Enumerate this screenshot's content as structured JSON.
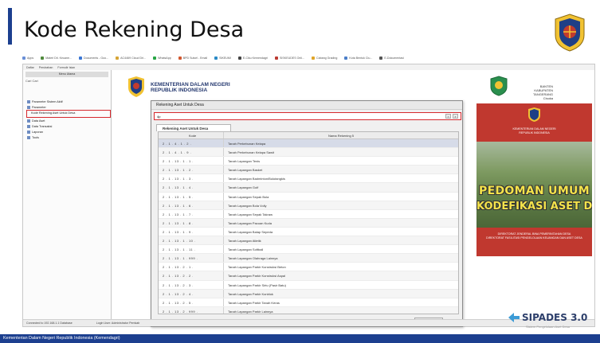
{
  "slide": {
    "title": "Kode Rekening Desa",
    "footer": "Kementerian Dalam Negeri Republik Indonesia (Kemendagri)",
    "accent_color": "#1c3f8f"
  },
  "bookmarks": [
    {
      "label": "Apps",
      "color": "#6a8fd6"
    },
    {
      "label": "Materi Dit. Keuane...",
      "color": "#4f8a3c"
    },
    {
      "label": "Documents - Goo...",
      "color": "#3a76d4"
    },
    {
      "label": "AC4469 Cloud Dri...",
      "color": "#d6a436"
    },
    {
      "label": "WhatsApp",
      "color": "#27a545"
    },
    {
      "label": "BPD Sulsel - Email",
      "color": "#d2582f"
    },
    {
      "label": "SIKEUMI",
      "color": "#2a8ac6"
    },
    {
      "label": "E-Ciku Kemendagri",
      "color": "#444444"
    },
    {
      "label": "SISKEUDES Onli...",
      "color": "#bb3a32"
    },
    {
      "label": "Cabang Grading",
      "color": "#e0a52a"
    },
    {
      "label": "Kota Bentuk Ciu...",
      "color": "#4b7ec9"
    },
    {
      "label": "E-Dokumentasi",
      "color": "#555555"
    }
  ],
  "app": {
    "menu": [
      "Daftar",
      "Perubahan",
      "Formulir Isian"
    ],
    "tree_header": "Menu Utama",
    "tree_tools": "Cari Cari",
    "tree_items": [
      "Parameter Sistem Aktif",
      "Parameter",
      "Kode Rekening Aset Untuk Desa",
      "Data Aset",
      "Data Transaksi",
      "Laporan",
      "Tools"
    ],
    "status_left": "Connected to 192.168.1.1 Database",
    "status_right": "Login User: Administrator Pemkab",
    "header": {
      "org_line1": "KEMENTERIAN DALAM NEGERI",
      "org_line2": "REPUBLIK INDONESIA",
      "region_line1": "BANTEN",
      "region_line2": "KABUPATEN TANGERANG",
      "region_line3": "Cisoka"
    }
  },
  "dialog": {
    "title": "Rekening Aset Untuk Desa",
    "search_value": "4p",
    "search_placeholder": "",
    "search_btn_1": "×",
    "search_btn_2": "⌕",
    "tab_label": "Rekening Aset Untuk Desa",
    "col_kode": "Kode",
    "col_nama": "Nama Rekening 5",
    "rows": [
      {
        "kode": "2 . 1 . 4 . 1 . 2 .",
        "nama": "Tanah Perkebunan Kelapa"
      },
      {
        "kode": "2 . 1 . 4 . 1 . 9 .",
        "nama": "Tanah Perkebunan Kelapa Sawit"
      },
      {
        "kode": "2 . 1 . 13 . 1 . 1 .",
        "nama": "Tanah Lapangan Tenis"
      },
      {
        "kode": "2 . 1 . 13 . 1 . 2 .",
        "nama": "Tanah Lapangan Basket"
      },
      {
        "kode": "2 . 1 . 13 . 1 . 3 .",
        "nama": "Tanah Lapangan Badminton/Bulutangkis"
      },
      {
        "kode": "2 . 1 . 13 . 1 . 4 .",
        "nama": "Tanah Lapangan Golf"
      },
      {
        "kode": "2 . 1 . 13 . 1 . 5 .",
        "nama": "Tanah Lapangan Sepak Bola"
      },
      {
        "kode": "2 . 1 . 13 . 1 . 6 .",
        "nama": "Tanah Lapangan Bola Volly"
      },
      {
        "kode": "2 . 1 . 13 . 1 . 7 .",
        "nama": "Tanah Lapangan Sepak Takraw"
      },
      {
        "kode": "2 . 1 . 13 . 1 . 8 .",
        "nama": "Tanah Lapangan Pacuan Kuda"
      },
      {
        "kode": "2 . 1 . 13 . 1 . 9 .",
        "nama": "Tanah Lapangan Balap Sepeda"
      },
      {
        "kode": "2 . 1 . 13 . 1 . 10 .",
        "nama": "Tanah Lapangan Atletik"
      },
      {
        "kode": "2 . 1 . 13 . 1 . 11 .",
        "nama": "Tanah Lapangan Softball"
      },
      {
        "kode": "2 . 1 . 13 . 1 . 999 .",
        "nama": "Tanah Lapangan Olahraga Lainnya"
      },
      {
        "kode": "2 . 1 . 13 . 2 . 1 .",
        "nama": "Tanah Lapangan Parkir Konstruksi Beton"
      },
      {
        "kode": "2 . 1 . 13 . 2 . 2 .",
        "nama": "Tanah Lapangan Parkir Konstruksi Aspal"
      },
      {
        "kode": "2 . 1 . 13 . 2 . 3 .",
        "nama": "Tanah Lapangan Parkir Sirtu (Pasir Batu)"
      },
      {
        "kode": "2 . 1 . 13 . 2 . 4 .",
        "nama": "Tanah Lapangan Parkir Konblok"
      },
      {
        "kode": "2 . 1 . 13 . 2 . 5 .",
        "nama": "Tanah Lapangan Parkir Tanah Keras"
      },
      {
        "kode": "2 . 1 . 13 . 2 . 999 .",
        "nama": "Tanah Lapangan Parkir Lainnya"
      }
    ],
    "close_label": "Tutup"
  },
  "book": {
    "top_line1": "KEMENTERIAN DALAM NEGERI",
    "top_line2": "REPUBLIK INDONESIA",
    "title_line1": "PEDOMAN UMUM",
    "title_line2": "KODEFIKASI ASET DESA",
    "foot_line1": "DIREKTORAT JENDERAL BINA PEMERINTAHAN DESA",
    "foot_line2": "DIREKTORAT FASILITASI PENGELOLAAN KEUANGAN DAN ASET DESA"
  },
  "brand": {
    "name": "SIPADES 3.0",
    "tagline": "Sistem Pengelolaan Aset Desa"
  }
}
